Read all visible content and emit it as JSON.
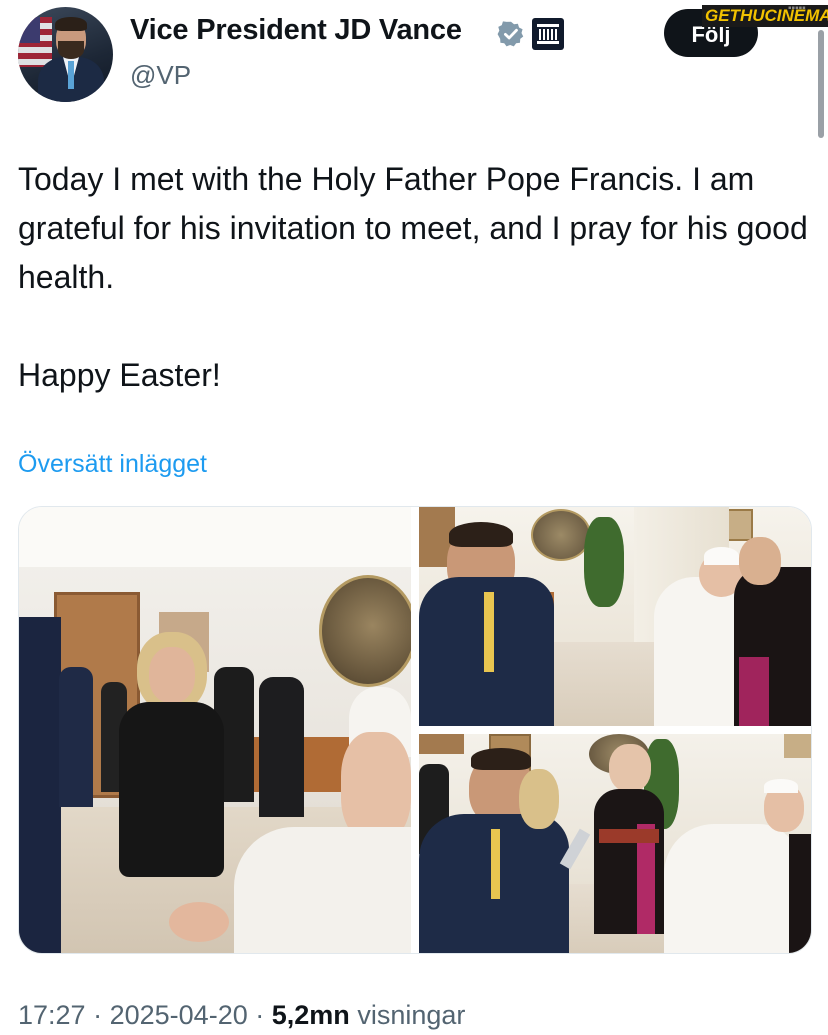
{
  "profile": {
    "name": "Vice President JD Vance",
    "handle": "@VP",
    "verified_icon": "verified-badge-icon",
    "affiliation_icon": "government-building-icon"
  },
  "follow_label": "Följ",
  "watermark": "GETHUCINEMA",
  "post": {
    "paragraphs": [
      "Today I met with the Holy Father Pope Francis. I am grateful for his invitation to meet, and I pray for his good health.",
      "Happy Easter!"
    ],
    "translate_label": "Översätt inlägget"
  },
  "meta": {
    "time": "17:27",
    "separator": "·",
    "date": "2025-04-20",
    "views": "5,2mn",
    "views_label": "visningar"
  },
  "colors": {
    "link": "#1d9bf0",
    "secondary_text": "#536471",
    "follow_button": "#0f1419",
    "verified_badge": "#829aab"
  }
}
